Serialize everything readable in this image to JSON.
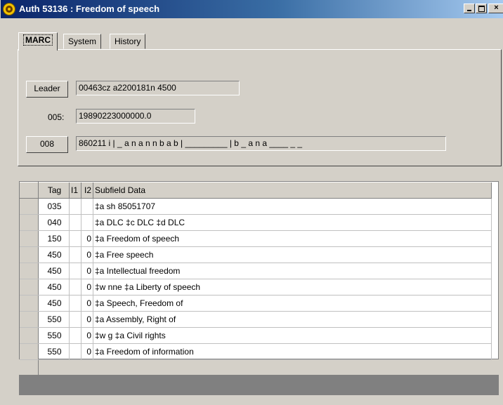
{
  "window": {
    "title": "Auth 53136 : Freedom of speech",
    "minimize_label": "_",
    "maximize_label": "□",
    "close_label": "×"
  },
  "tabs": [
    {
      "label": "MARC",
      "active": true
    },
    {
      "label": "System",
      "active": false
    },
    {
      "label": "History",
      "active": false
    }
  ],
  "marc": {
    "leader_button": "Leader",
    "leader_value": "00463cz  a2200181n  4500",
    "f005_label": "005:",
    "f005_value": "19890223000000.0",
    "f008_button": "008",
    "f008_value": "860211 i | _ a n a n n b a b |  _________ | b _ a n a ____ _ _"
  },
  "grid": {
    "headers": {
      "tag": "Tag",
      "i1": "I1",
      "i2": "I2",
      "data": "Subfield Data"
    },
    "rows": [
      {
        "tag": "035",
        "i1": "",
        "i2": "",
        "data": "‡a sh 85051707"
      },
      {
        "tag": "040",
        "i1": "",
        "i2": "",
        "data": "‡a DLC ‡c DLC ‡d DLC"
      },
      {
        "tag": "150",
        "i1": "",
        "i2": "0",
        "data": "‡a Freedom of speech"
      },
      {
        "tag": "450",
        "i1": "",
        "i2": "0",
        "data": "‡a Free speech"
      },
      {
        "tag": "450",
        "i1": "",
        "i2": "0",
        "data": "‡a Intellectual freedom"
      },
      {
        "tag": "450",
        "i1": "",
        "i2": "0",
        "data": "‡w nne ‡a Liberty of speech"
      },
      {
        "tag": "450",
        "i1": "",
        "i2": "0",
        "data": "‡a Speech, Freedom of"
      },
      {
        "tag": "550",
        "i1": "",
        "i2": "0",
        "data": "‡a Assembly, Right of"
      },
      {
        "tag": "550",
        "i1": "",
        "i2": "0",
        "data": "‡w g ‡a Civil rights"
      },
      {
        "tag": "550",
        "i1": "",
        "i2": "0",
        "data": "‡a Freedom of information"
      }
    ]
  }
}
